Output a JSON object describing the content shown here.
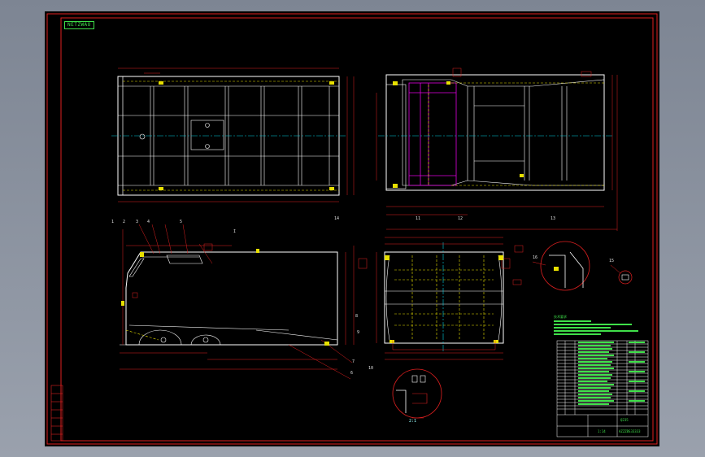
{
  "viewer": {
    "drawing_tag": "NETZWAO",
    "part_numbers": [
      "1",
      "2",
      "3",
      "4",
      "5",
      "6",
      "7",
      "8",
      "9",
      "10",
      "11",
      "12",
      "13",
      "14",
      "15",
      "16"
    ],
    "detail_label": "I",
    "scale_label": "2:1",
    "weld_note": "技术要求",
    "title_block": {
      "drawing_number": "AZZZBS33333",
      "scale": "1:14",
      "material": "Q235"
    }
  },
  "colors": {
    "background": "#000000",
    "frame": "#e02020",
    "geometry": "#ffffff",
    "centerline": "#00d0e0",
    "hidden": "#e8e000",
    "dimension": "#e02020",
    "accent": "#e000e0",
    "text_green": "#3fe04a"
  }
}
